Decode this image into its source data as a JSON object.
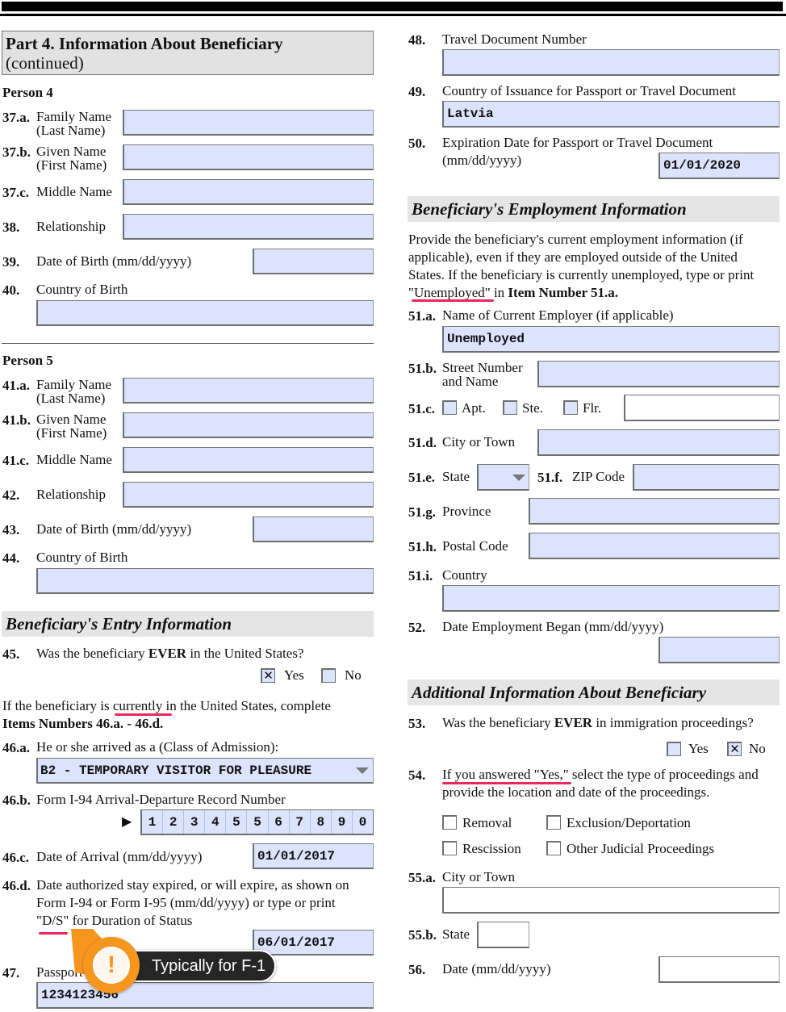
{
  "part_header": {
    "title": "Part 4.  Information About Beneficiary",
    "subtitle": "(continued)"
  },
  "person4": {
    "heading": "Person 4",
    "items": {
      "i37a": {
        "num": "37.a.",
        "label1": "Family Name",
        "label2": "(Last Name)",
        "value": ""
      },
      "i37b": {
        "num": "37.b.",
        "label1": "Given Name",
        "label2": "(First Name)",
        "value": ""
      },
      "i37c": {
        "num": "37.c.",
        "label": "Middle Name",
        "value": ""
      },
      "i38": {
        "num": "38.",
        "label": "Relationship",
        "value": ""
      },
      "i39": {
        "num": "39.",
        "label": "Date of Birth (mm/dd/yyyy)",
        "value": ""
      },
      "i40": {
        "num": "40.",
        "label": "Country of Birth",
        "value": ""
      }
    }
  },
  "person5": {
    "heading": "Person 5",
    "items": {
      "i41a": {
        "num": "41.a.",
        "label1": "Family Name",
        "label2": "(Last Name)",
        "value": ""
      },
      "i41b": {
        "num": "41.b.",
        "label1": "Given Name",
        "label2": "(First Name)",
        "value": ""
      },
      "i41c": {
        "num": "41.c.",
        "label": "Middle Name",
        "value": ""
      },
      "i42": {
        "num": "42.",
        "label": "Relationship",
        "value": ""
      },
      "i43": {
        "num": "43.",
        "label": "Date of Birth (mm/dd/yyyy)",
        "value": ""
      },
      "i44": {
        "num": "44.",
        "label": "Country of Birth",
        "value": ""
      }
    }
  },
  "entry": {
    "heading": "Beneficiary's Entry Information",
    "i45": {
      "num": "45.",
      "q_pre": "Was the beneficiary ",
      "q_bold": "EVER",
      "q_post": " in the United States?",
      "yes": "Yes",
      "no": "No",
      "yes_checked": true,
      "no_checked": false
    },
    "instr_line1": "If the beneficiary is currently in the United States, complete",
    "instr_line2": "Items Numbers 46.a. - 46.d.",
    "i46a": {
      "num": "46.a.",
      "label": "He or she arrived as a (Class of Admission):",
      "value": "B2 - TEMPORARY VISITOR FOR PLEASURE"
    },
    "i46b": {
      "num": "46.b.",
      "label": "Form I-94 Arrival-Departure Record Number",
      "digits": [
        "1",
        "2",
        "3",
        "4",
        "5",
        "5",
        "6",
        "7",
        "8",
        "9",
        "0"
      ]
    },
    "i46c": {
      "num": "46.c.",
      "label": "Date of Arrival (mm/dd/yyyy)",
      "value": "01/01/2017"
    },
    "i46d": {
      "num": "46.d.",
      "line1": "Date authorized stay expired, or will expire, as shown on",
      "line2": "Form I-94 or Form I-95 (mm/dd/yyyy) or type or print",
      "line3": "\"D/S\" for Duration of Status",
      "value": "06/01/2017"
    },
    "i47": {
      "num": "47.",
      "label": "Passport Number",
      "value": "1234123456"
    }
  },
  "callout": {
    "icon": "!",
    "text": "Typically for F-1",
    "color": "#f7961e"
  },
  "travel": {
    "i48": {
      "num": "48.",
      "label": "Travel Document Number",
      "value": ""
    },
    "i49": {
      "num": "49.",
      "label": "Country of Issuance for Passport or Travel Document",
      "value": "Latvia"
    },
    "i50": {
      "num": "50.",
      "label1": "Expiration Date for Passport or Travel Document",
      "label2": "(mm/dd/yyyy)",
      "value": "01/01/2020"
    }
  },
  "employment": {
    "heading": "Beneficiary's Employment Information",
    "para": [
      "Provide the beneficiary's current employment information (if",
      "applicable), even if they are employed outside of the United",
      "States.  If the beneficiary is currently unemployed, type or print"
    ],
    "para_last_pre": "\"Unemployed\" in ",
    "para_last_bold": "Item Number 51.a.",
    "i51a": {
      "num": "51.a.",
      "label": "Name of Current Employer (if applicable)",
      "value": "Unemployed"
    },
    "i51b": {
      "num": "51.b.",
      "label1": "Street Number",
      "label2": "and Name",
      "value": ""
    },
    "i51c": {
      "num": "51.c.",
      "apt": "Apt.",
      "ste": "Ste.",
      "flr": "Flr.",
      "value": ""
    },
    "i51d": {
      "num": "51.d.",
      "label": "City or Town",
      "value": ""
    },
    "i51e": {
      "num": "51.e.",
      "label": "State",
      "value": ""
    },
    "i51f": {
      "num": "51.f.",
      "label": "ZIP Code",
      "value": ""
    },
    "i51g": {
      "num": "51.g.",
      "label": "Province",
      "value": ""
    },
    "i51h": {
      "num": "51.h.",
      "label": "Postal Code",
      "value": ""
    },
    "i51i": {
      "num": "51.i.",
      "label": "Country",
      "value": ""
    },
    "i52": {
      "num": "52.",
      "label": "Date Employment Began (mm/dd/yyyy)",
      "value": ""
    }
  },
  "additional": {
    "heading": "Additional Information About Beneficiary",
    "i53": {
      "num": "53.",
      "q_pre": "Was the beneficiary ",
      "q_bold": "EVER",
      "q_post": " in immigration proceedings?",
      "yes": "Yes",
      "no": "No",
      "yes_checked": false,
      "no_checked": true
    },
    "i54": {
      "num": "54.",
      "line1": "If you answered \"Yes,\" select the type of proceedings and",
      "line2": "provide the location and date of the proceedings.",
      "options": {
        "removal": "Removal",
        "exclusion": "Exclusion/Deportation",
        "rescission": "Rescission",
        "other": "Other Judicial Proceedings"
      }
    },
    "i55a": {
      "num": "55.a.",
      "label": "City or Town",
      "value": ""
    },
    "i55b": {
      "num": "55.b.",
      "label": "State",
      "value": ""
    },
    "i56": {
      "num": "56.",
      "label": "Date (mm/dd/yyyy)",
      "value": ""
    }
  }
}
